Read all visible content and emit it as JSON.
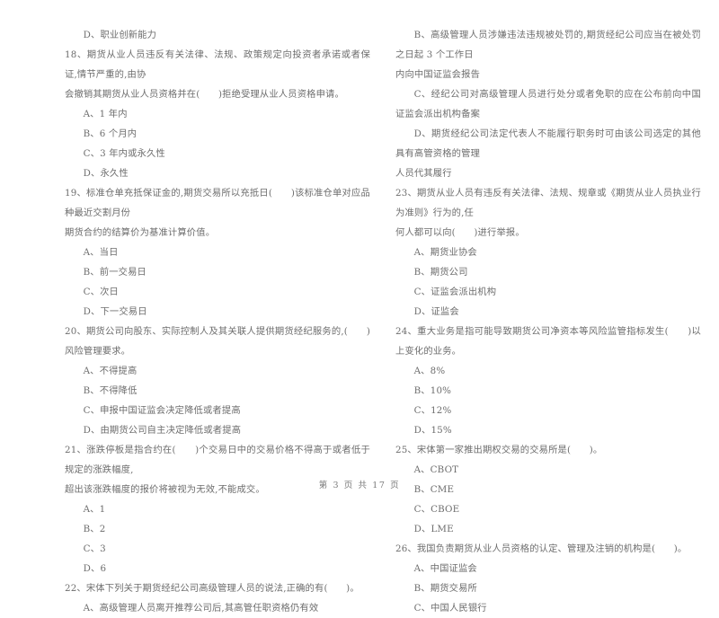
{
  "document": {
    "type": "exam-paper",
    "language": "zh-CN",
    "footer": "第 3 页 共 17 页"
  },
  "left_column": {
    "blocks": [
      {
        "kind": "option",
        "text": "D、职业创新能力"
      },
      {
        "kind": "stem",
        "text": "18、期货从业人员违反有关法律、法规、政策规定向投资者承诺或者保证,情节严重的,由协"
      },
      {
        "kind": "stem_cont",
        "text": "会撤销其期货从业人员资格并在(      )拒绝受理从业人员资格申请。"
      },
      {
        "kind": "option",
        "text": "A、1 年内"
      },
      {
        "kind": "option",
        "text": "B、6 个月内"
      },
      {
        "kind": "option",
        "text": "C、3 年内或永久性"
      },
      {
        "kind": "option",
        "text": "D、永久性"
      },
      {
        "kind": "stem",
        "text": "19、标准仓单充抵保证金的,期货交易所以充抵日(      )该标准仓单对应品种最近交割月份"
      },
      {
        "kind": "stem_cont",
        "text": "期货合约的结算价为基准计算价值。"
      },
      {
        "kind": "option",
        "text": "A、当日"
      },
      {
        "kind": "option",
        "text": "B、前一交易日"
      },
      {
        "kind": "option",
        "text": "C、次日"
      },
      {
        "kind": "option",
        "text": "D、下一交易日"
      },
      {
        "kind": "stem",
        "text": "20、期货公司向股东、实际控制人及其关联人提供期货经纪服务的,(      )风险管理要求。"
      },
      {
        "kind": "option",
        "text": "A、不得提高"
      },
      {
        "kind": "option",
        "text": "B、不得降低"
      },
      {
        "kind": "option",
        "text": "C、申报中国证监会决定降低或者提高"
      },
      {
        "kind": "option",
        "text": "D、由期货公司自主决定降低或者提高"
      },
      {
        "kind": "stem",
        "text": "21、涨跌停板是指合约在(      )个交易日中的交易价格不得高于或者低于规定的涨跌幅度,"
      },
      {
        "kind": "stem_cont",
        "text": "超出该涨跌幅度的报价将被视为无效,不能成交。"
      },
      {
        "kind": "option",
        "text": "A、1"
      },
      {
        "kind": "option",
        "text": "B、2"
      },
      {
        "kind": "option",
        "text": "C、3"
      },
      {
        "kind": "option",
        "text": "D、6"
      },
      {
        "kind": "stem",
        "text": "22、宋体下列关于期货经纪公司高级管理人员的说法,正确的有(      )。"
      },
      {
        "kind": "option",
        "text": "A、高级管理人员离开推荐公司后,其高管任职资格仍有效"
      }
    ]
  },
  "right_column": {
    "blocks": [
      {
        "kind": "option",
        "text": "B、高级管理人员涉嫌违法违规被处罚的,期货经纪公司应当在被处罚之日起 3 个工作日"
      },
      {
        "kind": "stem_cont",
        "text": "内向中国证监会报告"
      },
      {
        "kind": "option",
        "text": "C、经纪公司对高级管理人员进行处分或者免职的应在公布前向中国证监会派出机构备案"
      },
      {
        "kind": "option",
        "text": "D、期货经纪公司法定代表人不能履行职务时可由该公司选定的其他具有高管资格的管理"
      },
      {
        "kind": "stem_cont",
        "text": "人员代其履行"
      },
      {
        "kind": "stem",
        "text": "23、期货从业人员有违反有关法律、法规、规章或《期货从业人员执业行为准则》行为的,任"
      },
      {
        "kind": "stem_cont",
        "text": "何人都可以向(      )进行举报。"
      },
      {
        "kind": "option",
        "text": "A、期货业协会"
      },
      {
        "kind": "option",
        "text": "B、期货公司"
      },
      {
        "kind": "option",
        "text": "C、证监会派出机构"
      },
      {
        "kind": "option",
        "text": "D、证监会"
      },
      {
        "kind": "stem",
        "text": "24、重大业务是指可能导致期货公司净资本等风险监管指标发生(      )以上变化的业务。"
      },
      {
        "kind": "option",
        "text": "A、8%"
      },
      {
        "kind": "option",
        "text": "B、10%"
      },
      {
        "kind": "option",
        "text": "C、12%"
      },
      {
        "kind": "option",
        "text": "D、15%"
      },
      {
        "kind": "stem",
        "text": "25、宋体第一家推出期权交易的交易所是(      )。"
      },
      {
        "kind": "option",
        "text": "A、CBOT"
      },
      {
        "kind": "option",
        "text": "B、CME"
      },
      {
        "kind": "option",
        "text": "C、CBOE"
      },
      {
        "kind": "option",
        "text": "D、LME"
      },
      {
        "kind": "stem",
        "text": "26、我国负责期货从业人员资格的认定、管理及注销的机构是(      )。"
      },
      {
        "kind": "option",
        "text": "A、中国证监会"
      },
      {
        "kind": "option",
        "text": "B、期货交易所"
      },
      {
        "kind": "option",
        "text": "C、中国人民银行"
      }
    ]
  }
}
